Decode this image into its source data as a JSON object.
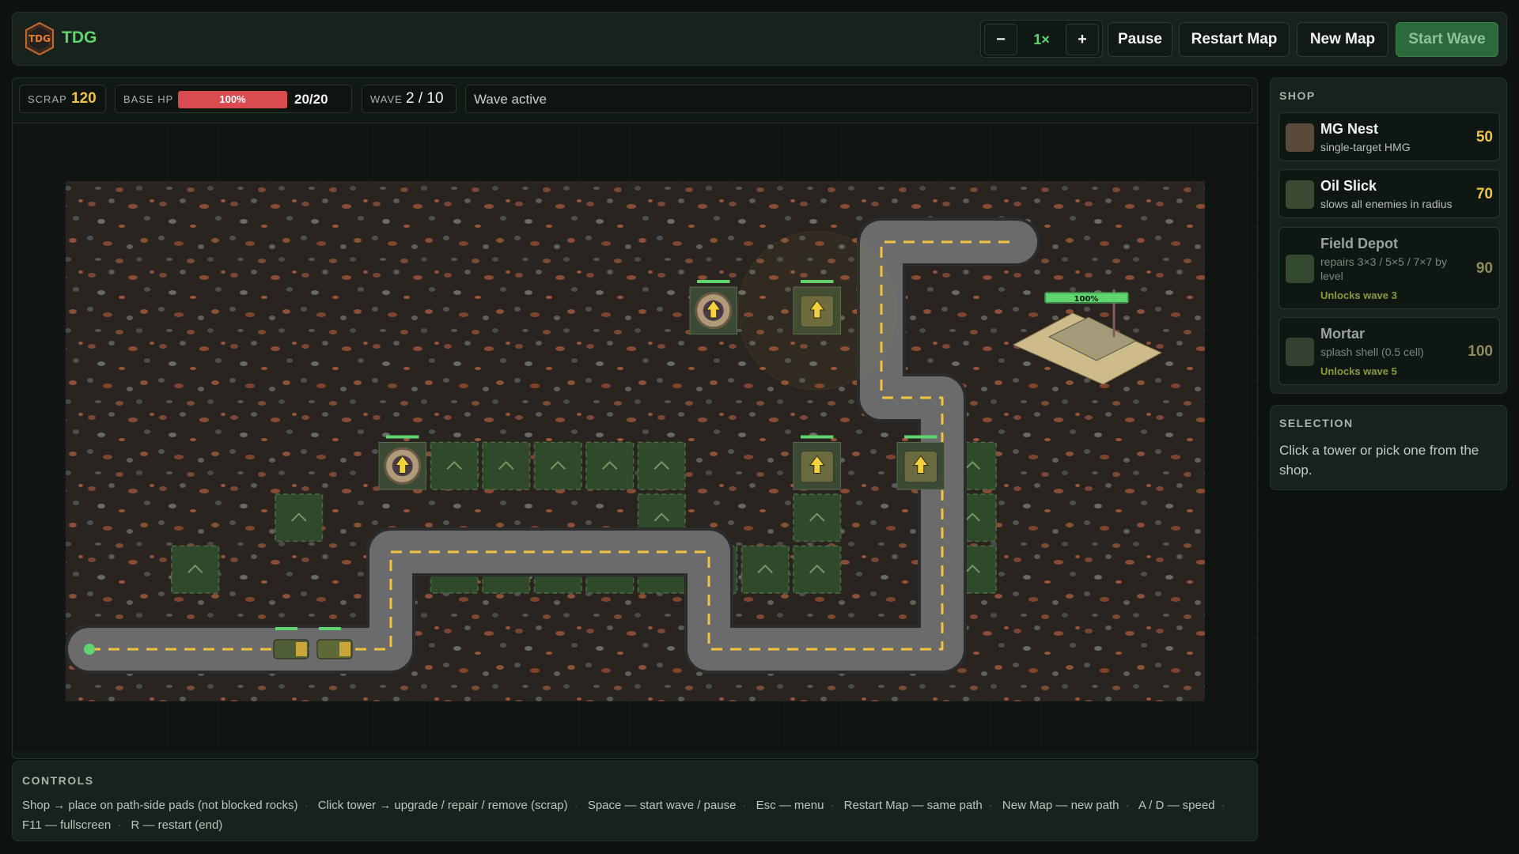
{
  "header": {
    "app_name": "TDG",
    "logo_text": "TDG",
    "speed_minus": "−",
    "speed_value": "1×",
    "speed_plus": "+",
    "pause_label": "Pause",
    "restart_map_label": "Restart Map",
    "new_map_label": "New Map",
    "start_wave_label": "Start Wave"
  },
  "status": {
    "scrap_label": "SCRAP",
    "scrap_value": "120",
    "base_hp_label": "BASE HP",
    "base_hp_percent": "100%",
    "base_hp_fraction": 1.0,
    "base_hp_value": "20/20",
    "wave_label": "WAVE",
    "wave_value": "2 / 10",
    "message": "Wave active"
  },
  "map": {
    "base_health_label": "100%",
    "base_health_fraction": 1.0
  },
  "shop": {
    "title": "SHOP",
    "items": [
      {
        "name": "MG Nest",
        "desc": "single-target HMG",
        "cost": "50",
        "locked": false,
        "icon": "mg-nest-icon"
      },
      {
        "name": "Oil Slick",
        "desc": "slows all enemies in radius",
        "cost": "70",
        "locked": false,
        "icon": "oil-slick-icon"
      },
      {
        "name": "Field Depot",
        "desc": "repairs 3×3 / 5×5 / 7×7 by level",
        "cost": "90",
        "locked": true,
        "unlock": "Unlocks wave 3",
        "icon": "field-depot-icon"
      },
      {
        "name": "Mortar",
        "desc": "splash shell (0.5 cell)",
        "cost": "100",
        "locked": true,
        "unlock": "Unlocks wave 5",
        "icon": "mortar-icon"
      }
    ]
  },
  "selection": {
    "title": "SELECTION",
    "text": "Click a tower or pick one from the shop."
  },
  "controls": {
    "title": "CONTROLS",
    "items": [
      "Shop → place on path-side pads (not blocked rocks)",
      "Click tower → upgrade / repair / remove (scrap)",
      "Space — start wave / pause",
      "Esc — menu",
      "Restart Map — same path",
      "New Map — new path",
      "A / D — speed",
      "F11 — fullscreen",
      "R — restart (end)"
    ]
  },
  "colors": {
    "accent": "#5fd46f",
    "scrap": "#f1c24a",
    "hp": "#d94b4f",
    "road": "#6b6b6b",
    "lane_marking": "#f2c33c",
    "pad": "#2f4a2b"
  }
}
